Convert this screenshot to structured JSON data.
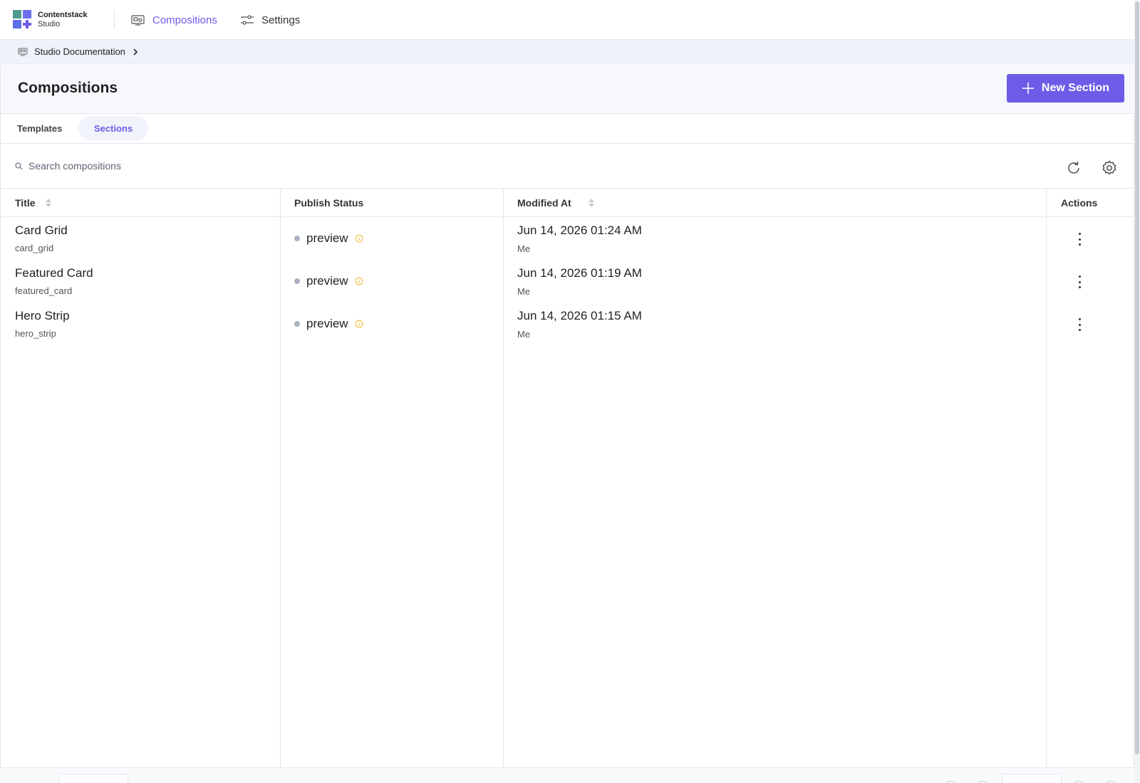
{
  "app": {
    "brand_name": "Contentstack",
    "brand_sub": "Studio"
  },
  "nav": {
    "compositions_label": "Compositions",
    "settings_label": "Settings"
  },
  "breadcrumb": {
    "project_label": "Studio Documentation"
  },
  "header": {
    "title": "Compositions",
    "new_button_label": "New Section"
  },
  "tabs": [
    {
      "label": "Templates",
      "active": false
    },
    {
      "label": "Sections",
      "active": true
    }
  ],
  "search": {
    "placeholder": "Search compositions",
    "value": ""
  },
  "table": {
    "columns": [
      "Title",
      "Publish Status",
      "Modified At",
      "Actions"
    ],
    "rows": [
      {
        "title": "Card Grid",
        "uid": "card_grid",
        "status": "preview",
        "modified_at": "Jun 14, 2026 01:24 AM",
        "modified_by": "Me"
      },
      {
        "title": "Featured Card",
        "uid": "featured_card",
        "status": "preview",
        "modified_at": "Jun 14, 2026 01:19 AM",
        "modified_by": "Me"
      },
      {
        "title": "Hero Strip",
        "uid": "hero_strip",
        "status": "preview",
        "modified_at": "Jun 14, 2026 01:15 AM",
        "modified_by": "Me"
      }
    ]
  },
  "colors": {
    "accent": "#6c5ce7",
    "status_dot": "#aab2c0",
    "info_icon": "#f0b429",
    "breadcrumb_bg": "#eef3fb"
  },
  "icons": {
    "logo": "contentstack-logo-icon",
    "compositions": "compositions-icon",
    "settings": "sliders-icon",
    "breadcrumb": "project-icon",
    "refresh": "refresh-icon",
    "gear": "gear-icon",
    "search": "search-icon",
    "info": "info-icon",
    "kebab": "kebab-menu-icon"
  }
}
